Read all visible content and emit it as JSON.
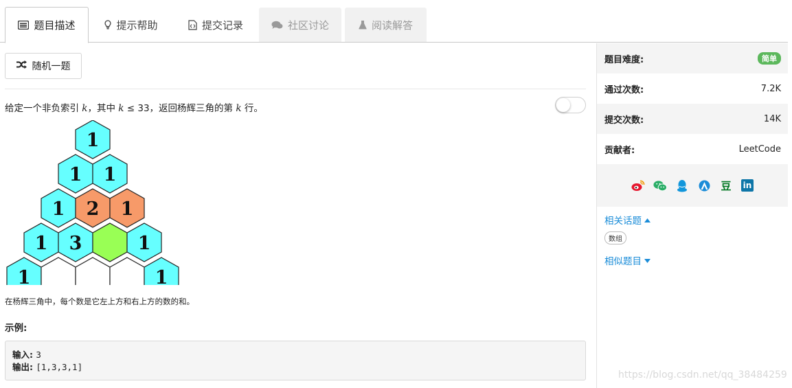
{
  "tabs": [
    {
      "label": "题目描述",
      "icon": "list-icon",
      "state": "active"
    },
    {
      "label": "提示帮助",
      "icon": "lightbulb-icon",
      "state": "normal"
    },
    {
      "label": "提交记录",
      "icon": "code-file-icon",
      "state": "normal"
    },
    {
      "label": "社区讨论",
      "icon": "comments-icon",
      "state": "disabled"
    },
    {
      "label": "阅读解答",
      "icon": "flask-icon",
      "state": "disabled"
    }
  ],
  "random_button": {
    "label": "随机一题",
    "icon": "shuffle-icon"
  },
  "problem": {
    "text_1": "给定一个非负索引 ",
    "var_k": "k",
    "text_2": "，其中 ",
    "var_k2": "k",
    "text_3": " ≤ 33，返回杨辉三角的第 ",
    "var_k3": "k",
    "text_4": " 行。",
    "triangle": {
      "rows": [
        [
          {
            "v": "1",
            "c": "cyan"
          }
        ],
        [
          {
            "v": "1",
            "c": "cyan"
          },
          {
            "v": "1",
            "c": "cyan"
          }
        ],
        [
          {
            "v": "1",
            "c": "cyan"
          },
          {
            "v": "2",
            "c": "orange"
          },
          {
            "v": "1",
            "c": "orange"
          }
        ],
        [
          {
            "v": "1",
            "c": "cyan"
          },
          {
            "v": "3",
            "c": "cyan"
          },
          {
            "v": "",
            "c": "green"
          },
          {
            "v": "1",
            "c": "cyan"
          }
        ],
        [
          {
            "v": "1",
            "c": "cyan"
          },
          {
            "v": "",
            "c": "white"
          },
          {
            "v": "",
            "c": "white"
          },
          {
            "v": "",
            "c": "white"
          },
          {
            "v": "1",
            "c": "cyan"
          }
        ]
      ],
      "colors": {
        "cyan": "#66ffff",
        "orange": "#f79a69",
        "green": "#99ff55",
        "white": "#ffffff"
      }
    },
    "caption": "在杨辉三角中，每个数是它左上方和右上方的数的和。",
    "example_title": "示例:",
    "example": {
      "input_label": "输入",
      "input_value": "3",
      "output_label": "输出",
      "output_value": "[1,3,3,1]"
    }
  },
  "sidebar": {
    "difficulty_label": "题目难度:",
    "difficulty_value": "简单",
    "accepted_label": "通过次数:",
    "accepted_value": "7.2K",
    "submissions_label": "提交次数:",
    "submissions_value": "14K",
    "contributor_label": "贡献者:",
    "contributor_value": "LeetCode",
    "share_icons": [
      "weibo-icon",
      "wechat-icon",
      "qq-icon",
      "qzone-icon",
      "douban-icon",
      "linkedin-icon"
    ],
    "douban_glyph": "豆",
    "linkedin_glyph": "in",
    "related_topics_label": "相关话题",
    "topic_tag": "数组",
    "similar_problems_label": "相似题目"
  },
  "watermark": "https://blog.csdn.net/qq_38484259",
  "accent": "#1a8cd8"
}
